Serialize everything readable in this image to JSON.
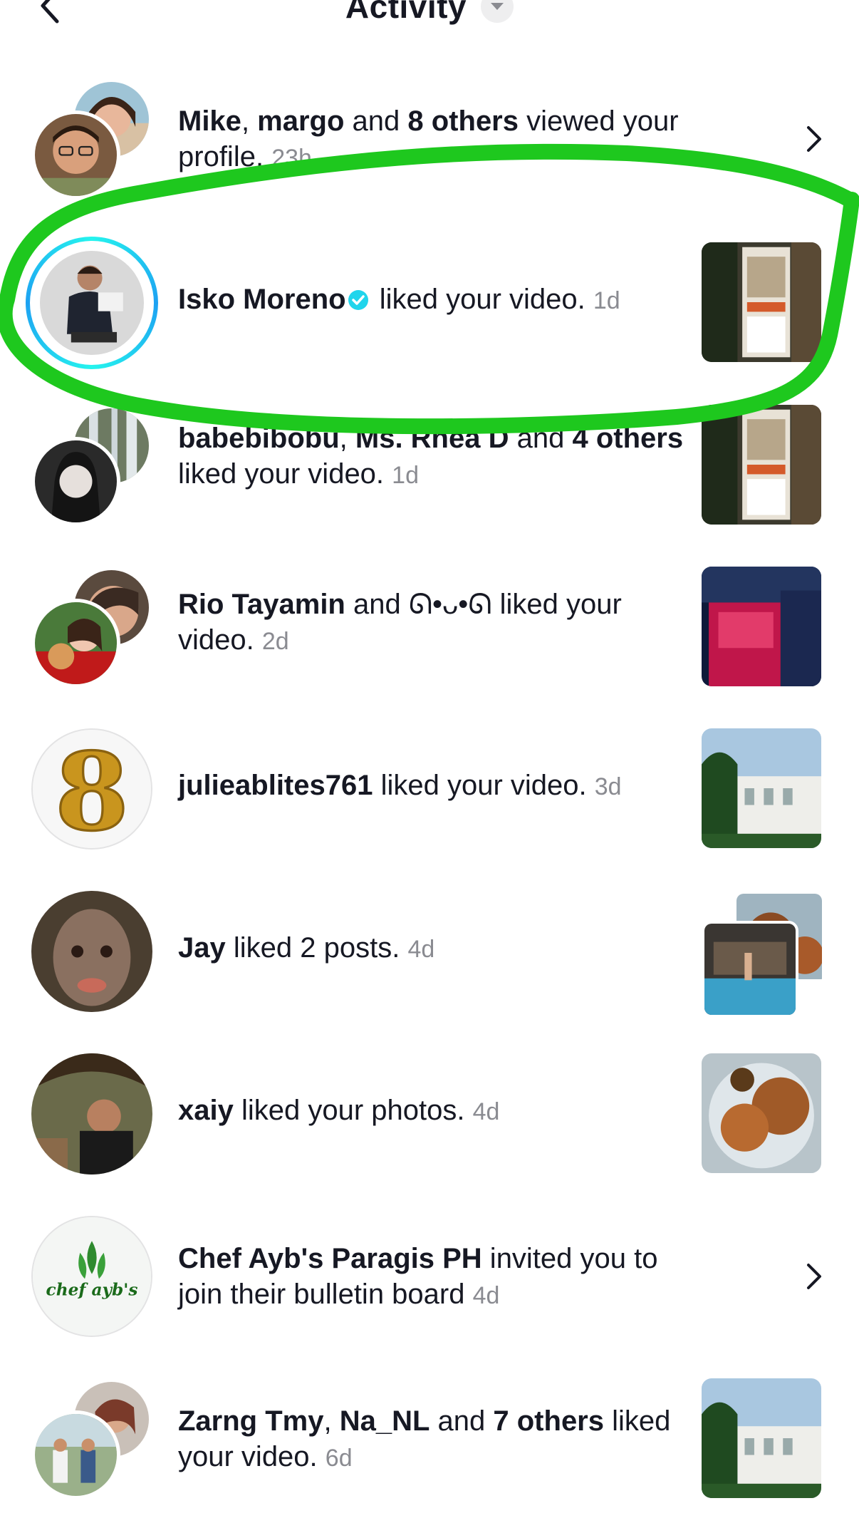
{
  "header": {
    "title": "Activity"
  },
  "notifications": [
    {
      "parts": [
        {
          "t": "Mike",
          "b": true
        },
        {
          "t": ", ",
          "b": false
        },
        {
          "t": "margo",
          "b": true
        },
        {
          "t": " and ",
          "b": false
        },
        {
          "t": "8 others",
          "b": true
        },
        {
          "t": " viewed your profile.",
          "b": false
        }
      ],
      "time": "23h",
      "trailing": "chevron"
    },
    {
      "parts": [
        {
          "t": "Isko Moreno",
          "b": true
        }
      ],
      "verified": true,
      "after": " liked your video.",
      "time": "1d",
      "trailing": "thumbnail"
    },
    {
      "parts": [
        {
          "t": "babebibobu",
          "b": true
        },
        {
          "t": ", ",
          "b": false
        },
        {
          "t": "Ms. Rhea D",
          "b": true
        },
        {
          "t": " and ",
          "b": false
        },
        {
          "t": "4 others",
          "b": true
        },
        {
          "t": " liked your video.",
          "b": false
        }
      ],
      "time": "1d",
      "trailing": "thumbnail"
    },
    {
      "parts": [
        {
          "t": "Rio Tayamin",
          "b": true
        },
        {
          "t": " and ",
          "b": false
        },
        {
          "t": "ᘏ•ᴗ•ᘏ",
          "b": false
        },
        {
          "t": " liked your video.",
          "b": false
        }
      ],
      "time": "2d",
      "trailing": "thumbnail"
    },
    {
      "parts": [
        {
          "t": "julieablites761",
          "b": true
        },
        {
          "t": " liked your video.",
          "b": false
        }
      ],
      "time": "3d",
      "trailing": "thumbnail"
    },
    {
      "parts": [
        {
          "t": "Jay",
          "b": true
        },
        {
          "t": " liked 2 posts.",
          "b": false
        }
      ],
      "time": "4d",
      "trailing": "thumbnail-stack"
    },
    {
      "parts": [
        {
          "t": "xaiy",
          "b": true
        },
        {
          "t": " liked your photos.",
          "b": false
        }
      ],
      "time": "4d",
      "trailing": "thumbnail"
    },
    {
      "parts": [
        {
          "t": "Chef Ayb's Paragis PH",
          "b": true
        },
        {
          "t": " invited you to join their bulletin board",
          "b": false
        }
      ],
      "time": "4d",
      "trailing": "chevron"
    },
    {
      "parts": [
        {
          "t": "Zarng Tmy",
          "b": true
        },
        {
          "t": ", ",
          "b": false
        },
        {
          "t": "Na_NL",
          "b": true
        },
        {
          "t": " and ",
          "b": false
        },
        {
          "t": "7 others",
          "b": true
        },
        {
          "t": " liked your video.",
          "b": false
        }
      ],
      "time": "6d",
      "trailing": "thumbnail"
    }
  ],
  "avatar_badge_digit": "8",
  "logo_text": "chef ayb's",
  "colors": {
    "annotation": "#1ec81e",
    "verified": "#20d5ec",
    "ring": "#25f4ee",
    "muted": "#8a8b91"
  },
  "icons": [
    "back-arrow-icon",
    "dropdown-caret-icon",
    "verified-badge-icon",
    "chevron-right-icon"
  ]
}
